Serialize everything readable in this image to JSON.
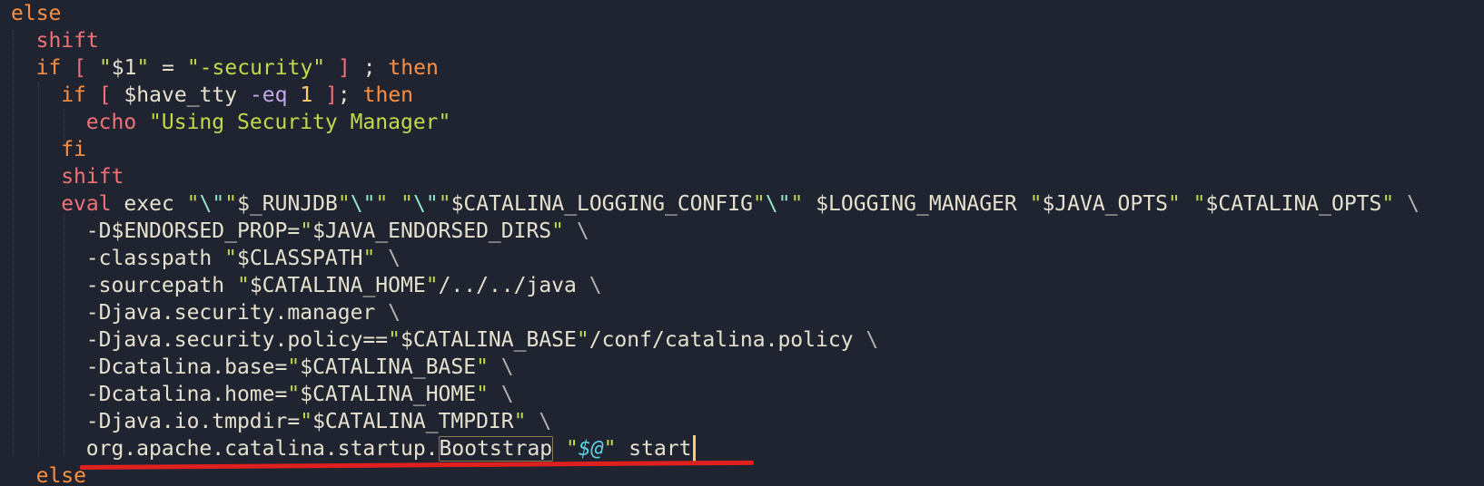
{
  "editor": {
    "lines": [
      {
        "id": "l1",
        "tokens": [
          {
            "t": "else",
            "c": "kw"
          }
        ]
      },
      {
        "id": "l2",
        "tokens": [
          {
            "t": "shift",
            "c": "cmd"
          }
        ]
      },
      {
        "id": "l3",
        "tokens": [
          {
            "t": "if",
            "c": "kw"
          },
          {
            "t": " ",
            "c": "pl"
          },
          {
            "t": "[",
            "c": "cmd"
          },
          {
            "t": " \"",
            "c": "str"
          },
          {
            "t": "$1",
            "c": "var"
          },
          {
            "t": "\"",
            "c": "str"
          },
          {
            "t": " = ",
            "c": "pl"
          },
          {
            "t": "\"-security\"",
            "c": "str"
          },
          {
            "t": " ",
            "c": "pl"
          },
          {
            "t": "]",
            "c": "cmd"
          },
          {
            "t": " ; ",
            "c": "pl"
          },
          {
            "t": "then",
            "c": "kw"
          }
        ]
      },
      {
        "id": "l4",
        "tokens": [
          {
            "t": "if",
            "c": "kw"
          },
          {
            "t": " ",
            "c": "pl"
          },
          {
            "t": "[",
            "c": "cmd"
          },
          {
            "t": " $have_tty ",
            "c": "var"
          },
          {
            "t": "-eq",
            "c": "op"
          },
          {
            "t": " ",
            "c": "pl"
          },
          {
            "t": "1",
            "c": "num"
          },
          {
            "t": " ",
            "c": "pl"
          },
          {
            "t": "]",
            "c": "cmd"
          },
          {
            "t": "; ",
            "c": "pl"
          },
          {
            "t": "then",
            "c": "kw"
          }
        ]
      },
      {
        "id": "l5",
        "tokens": [
          {
            "t": "echo",
            "c": "cmd"
          },
          {
            "t": " ",
            "c": "pl"
          },
          {
            "t": "\"Using Security Manager\"",
            "c": "str"
          }
        ]
      },
      {
        "id": "l6",
        "tokens": [
          {
            "t": "fi",
            "c": "kw"
          }
        ]
      },
      {
        "id": "l7",
        "tokens": [
          {
            "t": "shift",
            "c": "cmd"
          }
        ]
      },
      {
        "id": "l8",
        "tokens": [
          {
            "t": "eval",
            "c": "cmd"
          },
          {
            "t": " exec ",
            "c": "pl"
          },
          {
            "t": "\"",
            "c": "str"
          },
          {
            "t": "\\\"",
            "c": "esc"
          },
          {
            "t": "\"",
            "c": "str"
          },
          {
            "t": "$_RUNJDB",
            "c": "var"
          },
          {
            "t": "\"",
            "c": "str"
          },
          {
            "t": "\\\"",
            "c": "esc"
          },
          {
            "t": "\"",
            "c": "str"
          },
          {
            "t": " ",
            "c": "pl"
          },
          {
            "t": "\"",
            "c": "str"
          },
          {
            "t": "\\\"",
            "c": "esc"
          },
          {
            "t": "\"",
            "c": "str"
          },
          {
            "t": "$CATALINA_LOGGING_CONFIG",
            "c": "var"
          },
          {
            "t": "\"",
            "c": "str"
          },
          {
            "t": "\\\"",
            "c": "esc"
          },
          {
            "t": "\"",
            "c": "str"
          },
          {
            "t": " $LOGGING_MANAGER ",
            "c": "var"
          },
          {
            "t": "\"",
            "c": "str"
          },
          {
            "t": "$JAVA_OPTS",
            "c": "var"
          },
          {
            "t": "\"",
            "c": "str"
          },
          {
            "t": " ",
            "c": "pl"
          },
          {
            "t": "\"",
            "c": "str"
          },
          {
            "t": "$CATALINA_OPTS",
            "c": "var"
          },
          {
            "t": "\"",
            "c": "str"
          },
          {
            "t": " \\",
            "c": "bs"
          }
        ]
      },
      {
        "id": "l9",
        "tokens": [
          {
            "t": "-D$ENDORSED_PROP=",
            "c": "pl"
          },
          {
            "t": "\"",
            "c": "str"
          },
          {
            "t": "$JAVA_ENDORSED_DIRS",
            "c": "var"
          },
          {
            "t": "\"",
            "c": "str"
          },
          {
            "t": " \\",
            "c": "bs"
          }
        ]
      },
      {
        "id": "l10",
        "tokens": [
          {
            "t": "-classpath ",
            "c": "pl"
          },
          {
            "t": "\"",
            "c": "str"
          },
          {
            "t": "$CLASSPATH",
            "c": "var"
          },
          {
            "t": "\"",
            "c": "str"
          },
          {
            "t": " \\",
            "c": "bs"
          }
        ]
      },
      {
        "id": "l11",
        "tokens": [
          {
            "t": "-sourcepath ",
            "c": "pl"
          },
          {
            "t": "\"",
            "c": "str"
          },
          {
            "t": "$CATALINA_HOME",
            "c": "var"
          },
          {
            "t": "\"",
            "c": "str"
          },
          {
            "t": "/../../java",
            "c": "pl"
          },
          {
            "t": " \\",
            "c": "bs"
          }
        ]
      },
      {
        "id": "l12",
        "tokens": [
          {
            "t": "-Djava.security.manager",
            "c": "pl"
          },
          {
            "t": " \\",
            "c": "bs"
          }
        ]
      },
      {
        "id": "l13",
        "tokens": [
          {
            "t": "-Djava.security.policy==",
            "c": "pl"
          },
          {
            "t": "\"",
            "c": "str"
          },
          {
            "t": "$CATALINA_BASE",
            "c": "var"
          },
          {
            "t": "\"",
            "c": "str"
          },
          {
            "t": "/conf/catalina.policy",
            "c": "pl"
          },
          {
            "t": " \\",
            "c": "bs"
          }
        ]
      },
      {
        "id": "l14",
        "tokens": [
          {
            "t": "-Dcatalina.base=",
            "c": "pl"
          },
          {
            "t": "\"",
            "c": "str"
          },
          {
            "t": "$CATALINA_BASE",
            "c": "var"
          },
          {
            "t": "\"",
            "c": "str"
          },
          {
            "t": " \\",
            "c": "bs"
          }
        ]
      },
      {
        "id": "l15",
        "tokens": [
          {
            "t": "-Dcatalina.home=",
            "c": "pl"
          },
          {
            "t": "\"",
            "c": "str"
          },
          {
            "t": "$CATALINA_HOME",
            "c": "var"
          },
          {
            "t": "\"",
            "c": "str"
          },
          {
            "t": " \\",
            "c": "bs"
          }
        ]
      },
      {
        "id": "l16",
        "tokens": [
          {
            "t": "-Djava.io.tmpdir=",
            "c": "pl"
          },
          {
            "t": "\"",
            "c": "str"
          },
          {
            "t": "$CATALINA_TMPDIR",
            "c": "var"
          },
          {
            "t": "\"",
            "c": "str"
          },
          {
            "t": " \\",
            "c": "bs"
          }
        ]
      },
      {
        "id": "l17",
        "tokens": [
          {
            "t": "org.apache.catalina.startup.",
            "c": "pl"
          },
          {
            "t": "Bootstrap",
            "c": "pl hl"
          },
          {
            "t": " ",
            "c": "pl"
          },
          {
            "t": "\"",
            "c": "str"
          },
          {
            "t": "$@",
            "c": "spec"
          },
          {
            "t": "\"",
            "c": "str"
          },
          {
            "t": " start",
            "c": "pl"
          }
        ]
      },
      {
        "id": "l18",
        "tokens": [
          {
            "t": "else",
            "c": "kw"
          }
        ]
      }
    ]
  },
  "colors": {
    "background": "#1f2430",
    "keyword": "#ff8f40",
    "command": "#f07178",
    "string": "#c2d94c",
    "cursor": "#ffcc66",
    "annotation_underline": "#e0201e"
  }
}
